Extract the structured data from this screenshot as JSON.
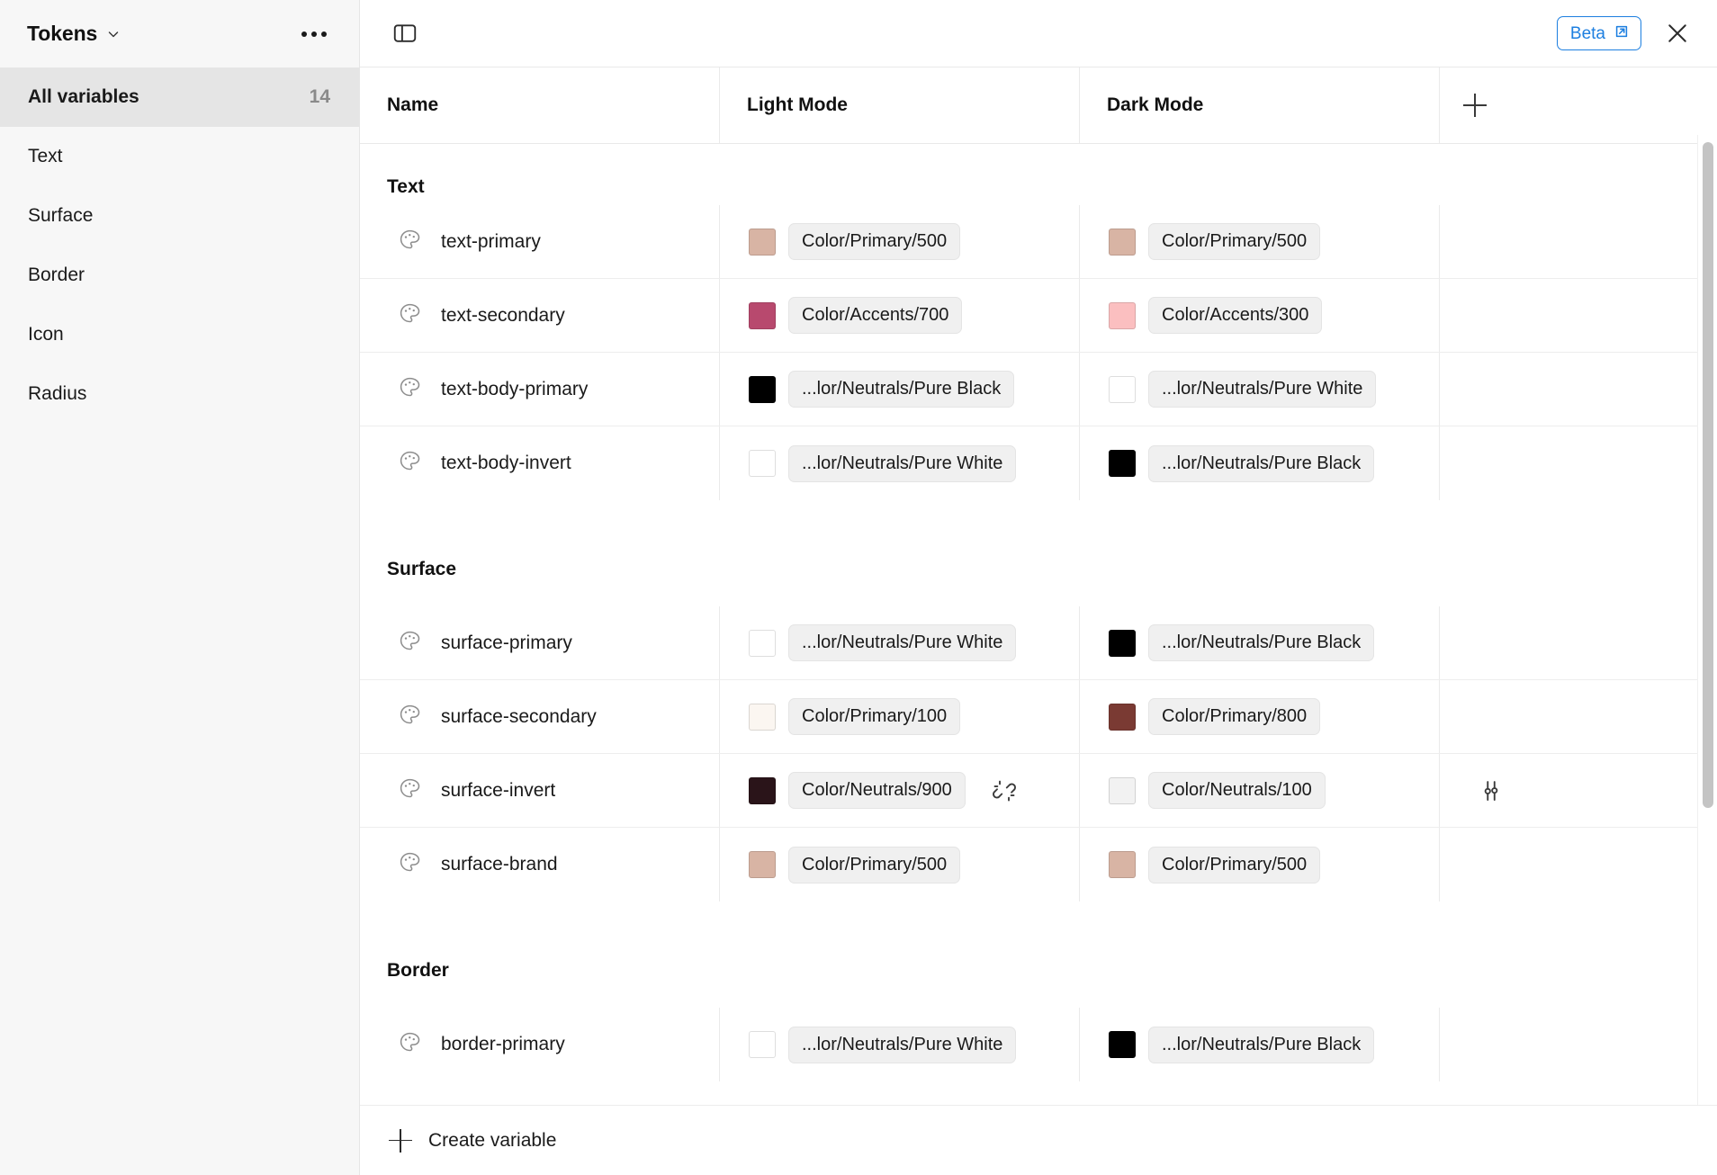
{
  "sidebar": {
    "collection_name": "Tokens",
    "chevron_icon": "chevron-down-icon",
    "more_icon": "more-horizontal-icon",
    "items": [
      {
        "label": "All variables",
        "count": "14",
        "active": true
      },
      {
        "label": "Text",
        "count": "",
        "active": false
      },
      {
        "label": "Surface",
        "count": "",
        "active": false
      },
      {
        "label": "Border",
        "count": "",
        "active": false
      },
      {
        "label": "Icon",
        "count": "",
        "active": false
      },
      {
        "label": "Radius",
        "count": "",
        "active": false
      }
    ]
  },
  "topbar": {
    "panel_toggle_icon": "sidebar-panel-toggle-icon",
    "beta_label": "Beta",
    "beta_external_icon": "external-link-icon",
    "close_icon": "close-icon"
  },
  "table": {
    "columns": {
      "name": "Name",
      "light_mode": "Light Mode",
      "dark_mode": "Dark Mode",
      "add_mode_icon": "plus-icon"
    },
    "groups": [
      {
        "title": "Text",
        "rows": [
          {
            "icon": "palette-icon",
            "name": "text-primary",
            "light": {
              "swatch": "#d8b4a4",
              "value": "Color/Primary/500"
            },
            "dark": {
              "swatch": "#d8b4a4",
              "value": "Color/Primary/500"
            },
            "row_action_icon": "",
            "extra_action_icon": ""
          },
          {
            "icon": "palette-icon",
            "name": "text-secondary",
            "light": {
              "swatch": "#b8496e",
              "value": "Color/Accents/700"
            },
            "dark": {
              "swatch": "#fbbfc0",
              "value": "Color/Accents/300"
            },
            "row_action_icon": "",
            "extra_action_icon": ""
          },
          {
            "icon": "palette-icon",
            "name": "text-body-primary",
            "light": {
              "swatch": "#000000",
              "value": "...lor/Neutrals/Pure Black"
            },
            "dark": {
              "swatch": "#ffffff",
              "value": "...lor/Neutrals/Pure White"
            },
            "row_action_icon": "",
            "extra_action_icon": ""
          },
          {
            "icon": "palette-icon",
            "name": "text-body-invert",
            "light": {
              "swatch": "#ffffff",
              "value": "...lor/Neutrals/Pure White"
            },
            "dark": {
              "swatch": "#000000",
              "value": "...lor/Neutrals/Pure Black"
            },
            "row_action_icon": "",
            "extra_action_icon": ""
          }
        ]
      },
      {
        "title": "Surface",
        "rows": [
          {
            "icon": "palette-icon",
            "name": "surface-primary",
            "light": {
              "swatch": "#ffffff",
              "value": "...lor/Neutrals/Pure White"
            },
            "dark": {
              "swatch": "#000000",
              "value": "...lor/Neutrals/Pure Black"
            },
            "row_action_icon": "",
            "extra_action_icon": ""
          },
          {
            "icon": "palette-icon",
            "name": "surface-secondary",
            "light": {
              "swatch": "#fbf6f1",
              "value": "Color/Primary/100"
            },
            "dark": {
              "swatch": "#7a3a33",
              "value": "Color/Primary/800"
            },
            "row_action_icon": "",
            "extra_action_icon": ""
          },
          {
            "icon": "palette-icon",
            "name": "surface-invert",
            "light": {
              "swatch": "#2a1419",
              "value": "Color/Neutrals/900"
            },
            "dark": {
              "swatch": "#f2f2f2",
              "value": "Color/Neutrals/100"
            },
            "row_action_icon": "unlink-icon",
            "extra_action_icon": "sliders-icon"
          },
          {
            "icon": "palette-icon",
            "name": "surface-brand",
            "light": {
              "swatch": "#d8b4a4",
              "value": "Color/Primary/500"
            },
            "dark": {
              "swatch": "#d8b4a4",
              "value": "Color/Primary/500"
            },
            "row_action_icon": "",
            "extra_action_icon": ""
          }
        ]
      },
      {
        "title": "Border",
        "rows": [
          {
            "icon": "palette-icon",
            "name": "border-primary",
            "light": {
              "swatch": "#ffffff",
              "value": "...lor/Neutrals/Pure White"
            },
            "dark": {
              "swatch": "#000000",
              "value": "...lor/Neutrals/Pure Black"
            },
            "row_action_icon": "",
            "extra_action_icon": ""
          }
        ]
      }
    ]
  },
  "footer": {
    "create_label": "Create variable",
    "create_icon": "plus-icon"
  },
  "colors": {
    "accent_blue": "#1d7fe0",
    "sidebar_bg": "#f7f7f7",
    "active_item_bg": "#e5e5e5"
  }
}
